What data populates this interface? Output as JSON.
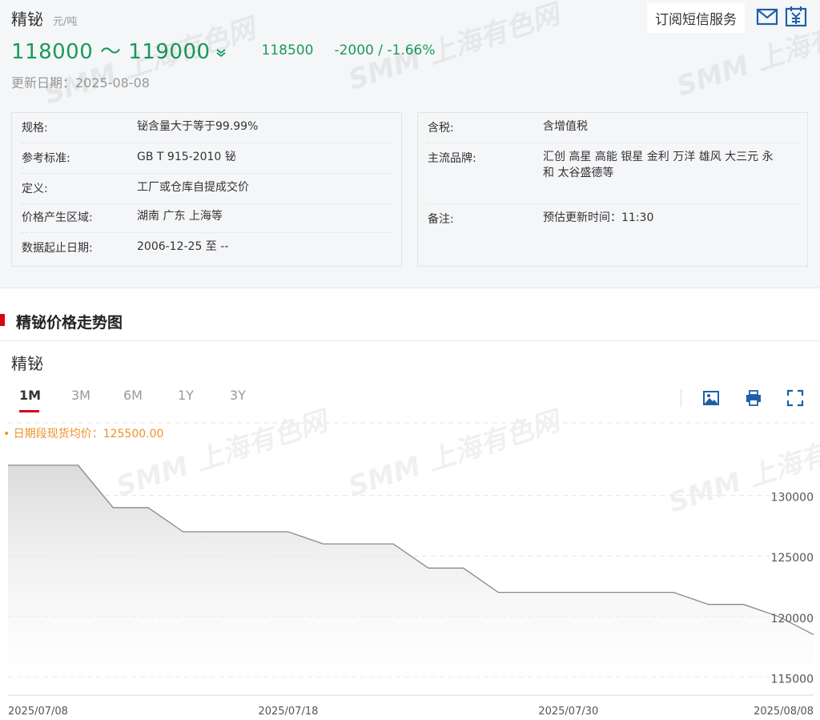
{
  "header": {
    "title": "精铋",
    "unit": "元/吨",
    "price_range": "118000 ～ 119000",
    "avg_price": "118500",
    "change": "-2000  /  -1.66%",
    "update_date": "更新日期：2025-08-08",
    "subscribe_label": "订阅短信服务",
    "price_color": "#1a9a5c"
  },
  "info_left": [
    {
      "key": "规格:",
      "value": "铋含量大于等于99.99%"
    },
    {
      "key": "参考标准:",
      "value": "GB T 915-2010 铋"
    },
    {
      "key": "定义:",
      "value": "工厂或仓库自提成交价"
    },
    {
      "key": "价格产生区域:",
      "value": "湖南 广东 上海等"
    },
    {
      "key": "数据起止日期:",
      "value": "2006-12-25 至 --"
    }
  ],
  "info_right": [
    {
      "key": "含税:",
      "value": "含增值税"
    },
    {
      "key": "主流品牌:",
      "value_line1": "汇创 高星 高能 银星 金利 万洋 雄风 大三元 永",
      "value_line2": "和 太谷盛德等"
    },
    {
      "key": "备注:",
      "value": "预估更新时间：11:30"
    }
  ],
  "section": {
    "title": "精铋价格走势图",
    "accent": "#d9001b"
  },
  "chart_panel": {
    "title": "精铋",
    "tabs": [
      "1M",
      "3M",
      "6M",
      "1Y",
      "3Y"
    ],
    "active_tab": "1M",
    "avg_label": "• 日期段现货均价：125500.00",
    "watermark": "SMM 上海有色网"
  },
  "chart_data": {
    "type": "area",
    "title": "",
    "xlabel": "",
    "ylabel": "",
    "x": [
      "2025-07-08",
      "2025-07-09",
      "2025-07-10",
      "2025-07-11",
      "2025-07-14",
      "2025-07-15",
      "2025-07-16",
      "2025-07-17",
      "2025-07-18",
      "2025-07-21",
      "2025-07-22",
      "2025-07-23",
      "2025-07-24",
      "2025-07-25",
      "2025-07-28",
      "2025-07-29",
      "2025-07-30",
      "2025-07-31",
      "2025-08-01",
      "2025-08-04",
      "2025-08-05",
      "2025-08-06",
      "2025-08-07",
      "2025-08-08"
    ],
    "values": [
      132500,
      132500,
      132500,
      129000,
      129000,
      127000,
      127000,
      127000,
      127000,
      126000,
      126000,
      126000,
      124000,
      124000,
      122000,
      122000,
      122000,
      122000,
      122000,
      122000,
      121000,
      121000,
      120000,
      118500
    ],
    "x_tick_labels": [
      "2025/07/08",
      "2025/07/18",
      "2025/07/30",
      "2025/08/08"
    ],
    "y_ticks": [
      115000,
      120000,
      125000,
      130000
    ],
    "ylim": [
      113500,
      136000
    ],
    "grid": true,
    "line_color": "#888888",
    "fill_color": "#dddddd"
  }
}
